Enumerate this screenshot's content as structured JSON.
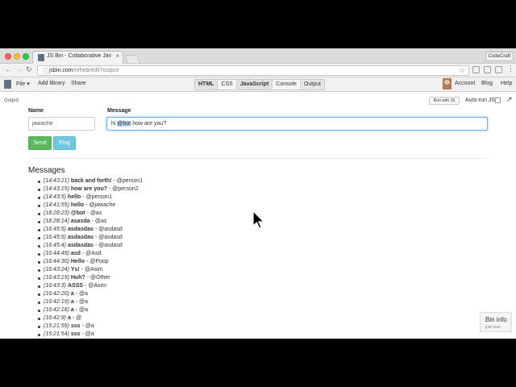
{
  "browser": {
    "tab_title": "JS Bin - Collaborative JavaScript",
    "tab_close": "×",
    "profile": "CodeCraft",
    "url_host": "jsbin.com",
    "url_path": "/reheb/edit?output"
  },
  "toolbar": {
    "file": "File ▾",
    "add_library": "Add library",
    "share": "Share",
    "panels": [
      "HTML",
      "CSS",
      "JavaScript",
      "Console",
      "Output"
    ],
    "account": "Account",
    "blog": "Blog",
    "help": "Help"
  },
  "output": {
    "label": "Output",
    "run_button": "Run with JS",
    "autorun_label": "Auto-run JS"
  },
  "form": {
    "name_label": "Name",
    "name_value": "jawache",
    "message_label": "Message",
    "message_prefix": "hi ",
    "message_selected": "@bot",
    "message_suffix": " how are you?",
    "send_label": "Send",
    "ping_label": "Ping"
  },
  "messages": {
    "title": "Messages",
    "items": [
      {
        "time": "(14:43:21)",
        "text": "back and forth!",
        "user": "@person1"
      },
      {
        "time": "(14:43:15)",
        "text": "how are you?",
        "user": "@person2"
      },
      {
        "time": "(14:43:5)",
        "text": "hello",
        "user": "@person1"
      },
      {
        "time": "(14:41:55)",
        "text": "hello",
        "user": "@jawache"
      },
      {
        "time": "(18:28:23)",
        "text": "@bot",
        "user": "@as"
      },
      {
        "time": "(18:28:14)",
        "text": "asasda",
        "user": "@as"
      },
      {
        "time": "(16:45:5)",
        "text": "asdasdas",
        "user": "@asdasd"
      },
      {
        "time": "(16:45:5)",
        "text": "asdasdas",
        "user": "@asdasd"
      },
      {
        "time": "(16:45:4)",
        "text": "asdasdas",
        "user": "@asdasd"
      },
      {
        "time": "(16:44:49)",
        "text": "asd",
        "user": "@Asd"
      },
      {
        "time": "(16:44:30)",
        "text": "Hello",
        "user": "@Poop"
      },
      {
        "time": "(16:43:24)",
        "text": "Ys!",
        "user": "@Asim"
      },
      {
        "time": "(16:43:19)",
        "text": "Huh?",
        "user": "@Other"
      },
      {
        "time": "(16:43:3)",
        "text": "ASSS",
        "user": "@Asim"
      },
      {
        "time": "(16:42:20)",
        "text": "a",
        "user": "@a"
      },
      {
        "time": "(16:42:19)",
        "text": "a",
        "user": "@a"
      },
      {
        "time": "(16:42:18)",
        "text": "a",
        "user": "@a"
      },
      {
        "time": "(16:42:9)",
        "text": "a",
        "user": "@"
      },
      {
        "time": "(15:21:55)",
        "text": "sss",
        "user": "@a"
      },
      {
        "time": "(15:21:54)",
        "text": "sss",
        "user": "@a"
      }
    ]
  },
  "bin_info": {
    "title": "Bin info",
    "subtitle": "just now"
  },
  "colors": {
    "send": "#5cb85c",
    "ping": "#6ec7de",
    "focus": "#66afe9"
  }
}
